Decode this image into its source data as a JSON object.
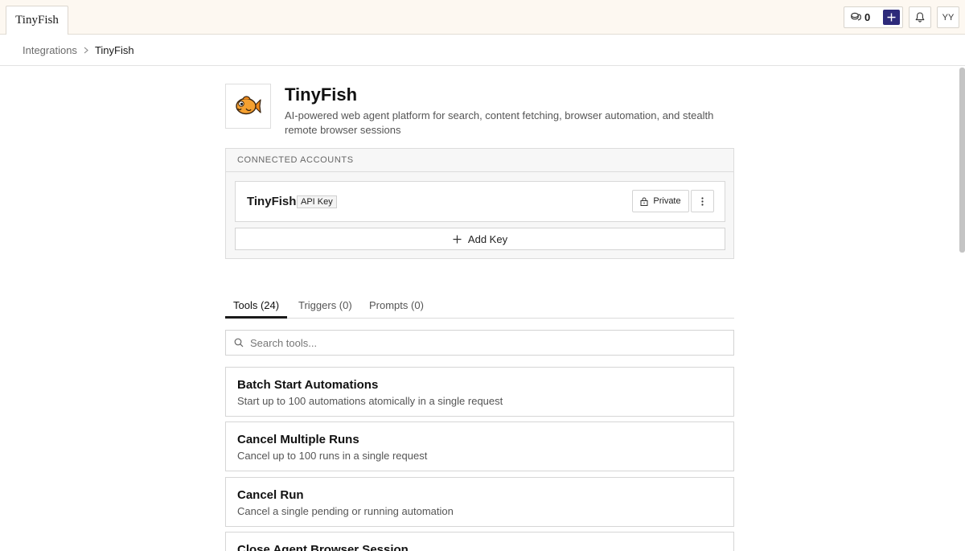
{
  "topbar": {
    "tab_label": "TinyFish",
    "credits_count": "0",
    "avatar_initials": "YY"
  },
  "breadcrumb": {
    "parent": "Integrations",
    "current": "TinyFish"
  },
  "integration": {
    "name": "TinyFish",
    "description": "AI-powered web agent platform for search, content fetching, browser automation, and stealth remote browser sessions"
  },
  "accounts": {
    "heading": "CONNECTED ACCOUNTS",
    "items": [
      {
        "name": "TinyFish",
        "badge": "API Key",
        "visibility": "Private"
      }
    ],
    "add_key_label": "Add Key"
  },
  "tabs": [
    {
      "label": "Tools (24)",
      "active": true
    },
    {
      "label": "Triggers (0)",
      "active": false
    },
    {
      "label": "Prompts (0)",
      "active": false
    }
  ],
  "search": {
    "placeholder": "Search tools..."
  },
  "tools": [
    {
      "title": "Batch Start Automations",
      "description": "Start up to 100 automations atomically in a single request"
    },
    {
      "title": "Cancel Multiple Runs",
      "description": "Cancel up to 100 runs in a single request"
    },
    {
      "title": "Cancel Run",
      "description": "Cancel a single pending or running automation"
    },
    {
      "title": "Close Agent Browser Session",
      "description": ""
    }
  ],
  "colors": {
    "topbar_bg": "#fdf8f1",
    "accent": "#2d2a7a",
    "logo_orange": "#f08a1c"
  },
  "icons": {
    "credits": "coins-icon",
    "new": "plus-icon",
    "notifications": "bell-icon",
    "lock": "lock-icon",
    "more": "vertical-dots-icon",
    "search": "search-icon",
    "logo": "fish-logo-icon"
  }
}
